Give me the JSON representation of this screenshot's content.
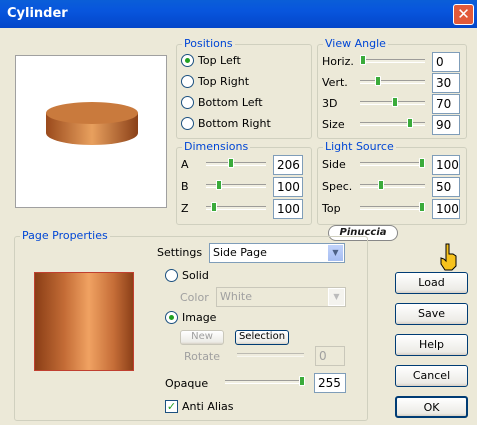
{
  "window": {
    "title": "Cylinder",
    "close_icon": "close-icon"
  },
  "positions": {
    "label": "Positions",
    "options": [
      "Top Left",
      "Top Right",
      "Bottom Left",
      "Bottom Right"
    ],
    "selected": "Top Left"
  },
  "view_angle": {
    "label": "View Angle",
    "rows": [
      {
        "label": "Horiz.",
        "value": "0",
        "level": 0
      },
      {
        "label": "Vert.",
        "value": "30",
        "level": 0.25
      },
      {
        "label": "3D",
        "value": "70",
        "level": 0.55
      },
      {
        "label": "Size",
        "value": "90",
        "level": 0.8
      }
    ]
  },
  "dimensions": {
    "label": "Dimensions",
    "rows": [
      {
        "label": "A",
        "value": "206",
        "level": 0.4
      },
      {
        "label": "B",
        "value": "100",
        "level": 0.18
      },
      {
        "label": "Z",
        "value": "100",
        "level": 0.1
      }
    ]
  },
  "light_source": {
    "label": "Light Source",
    "rows": [
      {
        "label": "Side",
        "value": "100",
        "level": 1
      },
      {
        "label": "Spec.",
        "value": "50",
        "level": 0.3
      },
      {
        "label": "Top",
        "value": "100",
        "level": 1
      }
    ]
  },
  "page_properties": {
    "label": "Page Properties",
    "settings_label": "Settings",
    "settings_value": "Side Page",
    "solid_label": "Solid",
    "color_label": "Color",
    "color_value": "White",
    "image_label": "Image",
    "new_label": "New",
    "selection_label": "Selection",
    "rotate_label": "Rotate",
    "rotate_value": "0",
    "opaque_label": "Opaque",
    "opaque_value": "255",
    "opaque_level": 1,
    "anti_alias_label": "Anti Alias",
    "anti_alias_checked": true
  },
  "buttons": {
    "load": "Load",
    "save": "Save",
    "help": "Help",
    "cancel": "Cancel",
    "ok": "OK"
  },
  "watermark": "Pinuccia",
  "colors": {
    "cylinder": "#d98a4a",
    "accent_label": "#0046d5",
    "titlebar": "#0855dd"
  }
}
